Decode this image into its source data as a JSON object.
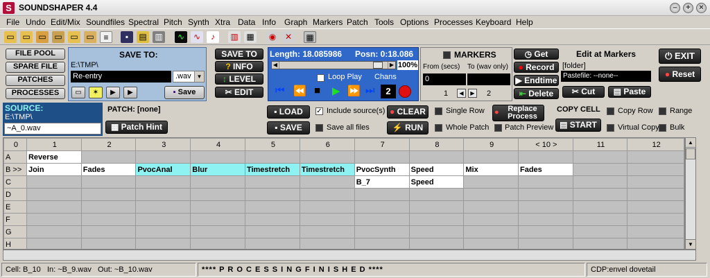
{
  "title_bar": {
    "logo_letter": "S",
    "title": "SOUNDSHAPER 4.4"
  },
  "menu": [
    "File",
    "Undo",
    "Edit/Mix",
    "Soundfiles",
    "Spectral",
    "Pitch",
    "Synth",
    "Xtra",
    "Data",
    "Info",
    "Graph",
    "Markers",
    "Patch",
    "Tools",
    "Options",
    "Processes",
    "Keyboard",
    "Help"
  ],
  "left_buttons": {
    "file_pool": "FILE POOL",
    "spare_file": "SPARE FILE",
    "patches": "PATCHES",
    "processes": "PROCESSES"
  },
  "save_to": {
    "title": "SAVE TO:",
    "path": "E:\\TMP\\",
    "filename": "Re-entry",
    "extension": ".wav",
    "save_label": "Save"
  },
  "mid_buttons": {
    "save_to": "SAVE TO",
    "info": "INFO",
    "level": "LEVEL",
    "edit": "EDIT"
  },
  "transport": {
    "length_label": "Length: 18.085986",
    "posn_label": "Posn: 0:18.086",
    "zoom": "100%",
    "loop_play": "Loop Play",
    "chans_label": "Chans",
    "chans_value": "2",
    "position_fraction": 0.95
  },
  "markers": {
    "title": "MARKERS",
    "from_label": "From (secs)",
    "to_label": "To (wav only)",
    "from_value": "0",
    "to_value": "",
    "index": "1",
    "count": "2"
  },
  "edit_markers": {
    "get": "Get",
    "title": "Edit at Markers",
    "folder": "[folder]",
    "record": "Record",
    "endtime": "Endtime",
    "pastefile": "Pastefile: --none--",
    "delete": "Delete",
    "cut": "Cut",
    "paste": "Paste"
  },
  "right_buttons": {
    "exit": "EXIT",
    "reset": "Reset"
  },
  "source": {
    "label": "SOURCE:",
    "path": "E:\\TMP\\",
    "filename": "~A_0.wav"
  },
  "patch": {
    "title": "PATCH: [none]",
    "patch_hint": "Patch Hint",
    "load": "LOAD",
    "save": "SAVE",
    "include_sources": "Include source(s)",
    "save_all_files": "Save all files",
    "clear": "CLEAR",
    "run": "RUN",
    "single_row": "Single Row",
    "whole_patch": "Whole Patch",
    "replace_process": "Replace Process",
    "patch_preview": "Patch Preview"
  },
  "copy_cell": {
    "title": "COPY CELL",
    "start": "START",
    "copy_row": "Copy Row",
    "range": "Range",
    "virtual_copy": "Virtual Copy",
    "bulk": "Bulk"
  },
  "grid": {
    "columns": [
      "0",
      "1",
      "2",
      "3",
      "4",
      "5",
      "6",
      "7",
      "8",
      "9",
      "< 10 >",
      "11",
      "12"
    ],
    "rows": [
      {
        "label": "A",
        "cells": [
          {
            "t": "Reverse",
            "s": "w"
          },
          {
            "t": "",
            "s": "e"
          },
          {
            "t": "",
            "s": "e"
          },
          {
            "t": "",
            "s": "e"
          },
          {
            "t": "",
            "s": "e"
          },
          {
            "t": "",
            "s": "e"
          },
          {
            "t": "",
            "s": "e"
          },
          {
            "t": "",
            "s": "e"
          },
          {
            "t": "",
            "s": "e"
          },
          {
            "t": "",
            "s": "e"
          },
          {
            "t": "",
            "s": "e"
          },
          {
            "t": "",
            "s": "e"
          }
        ]
      },
      {
        "label": "B >>",
        "cells": [
          {
            "t": "Join",
            "s": "w"
          },
          {
            "t": "Fades",
            "s": "w"
          },
          {
            "t": "PvocAnal",
            "s": "c"
          },
          {
            "t": "Blur",
            "s": "c"
          },
          {
            "t": "Timestretch",
            "s": "c"
          },
          {
            "t": "Timestretch",
            "s": "c"
          },
          {
            "t": "PvocSynth",
            "s": "w"
          },
          {
            "t": "Speed",
            "s": "w"
          },
          {
            "t": "Mix",
            "s": "w"
          },
          {
            "t": "Fades",
            "s": "w"
          },
          {
            "t": "",
            "s": "e"
          },
          {
            "t": "",
            "s": "e"
          }
        ]
      },
      {
        "label": "C",
        "cells": [
          {
            "t": "",
            "s": "e"
          },
          {
            "t": "",
            "s": "e"
          },
          {
            "t": "",
            "s": "e"
          },
          {
            "t": "",
            "s": "e"
          },
          {
            "t": "",
            "s": "e"
          },
          {
            "t": "",
            "s": "e"
          },
          {
            "t": "B_7",
            "s": "w"
          },
          {
            "t": "Speed",
            "s": "w"
          },
          {
            "t": "",
            "s": "e"
          },
          {
            "t": "",
            "s": "e"
          },
          {
            "t": "",
            "s": "e"
          },
          {
            "t": "",
            "s": "e"
          }
        ]
      },
      {
        "label": "D",
        "cells": [
          {
            "t": "",
            "s": "e"
          },
          {
            "t": "",
            "s": "e"
          },
          {
            "t": "",
            "s": "e"
          },
          {
            "t": "",
            "s": "e"
          },
          {
            "t": "",
            "s": "e"
          },
          {
            "t": "",
            "s": "e"
          },
          {
            "t": "",
            "s": "e"
          },
          {
            "t": "",
            "s": "e"
          },
          {
            "t": "",
            "s": "e"
          },
          {
            "t": "",
            "s": "e"
          },
          {
            "t": "",
            "s": "e"
          },
          {
            "t": "",
            "s": "e"
          }
        ]
      },
      {
        "label": "E",
        "cells": [
          {
            "t": "",
            "s": "e"
          },
          {
            "t": "",
            "s": "e"
          },
          {
            "t": "",
            "s": "e"
          },
          {
            "t": "",
            "s": "e"
          },
          {
            "t": "",
            "s": "e"
          },
          {
            "t": "",
            "s": "e"
          },
          {
            "t": "",
            "s": "e"
          },
          {
            "t": "",
            "s": "e"
          },
          {
            "t": "",
            "s": "e"
          },
          {
            "t": "",
            "s": "e"
          },
          {
            "t": "",
            "s": "e"
          },
          {
            "t": "",
            "s": "e"
          }
        ]
      },
      {
        "label": "F",
        "cells": [
          {
            "t": "",
            "s": "e"
          },
          {
            "t": "",
            "s": "e"
          },
          {
            "t": "",
            "s": "e"
          },
          {
            "t": "",
            "s": "e"
          },
          {
            "t": "",
            "s": "e"
          },
          {
            "t": "",
            "s": "e"
          },
          {
            "t": "",
            "s": "e"
          },
          {
            "t": "",
            "s": "e"
          },
          {
            "t": "",
            "s": "e"
          },
          {
            "t": "",
            "s": "e"
          },
          {
            "t": "",
            "s": "e"
          },
          {
            "t": "",
            "s": "e"
          }
        ]
      },
      {
        "label": "G",
        "cells": [
          {
            "t": "",
            "s": "e"
          },
          {
            "t": "",
            "s": "e"
          },
          {
            "t": "",
            "s": "e"
          },
          {
            "t": "",
            "s": "e"
          },
          {
            "t": "",
            "s": "e"
          },
          {
            "t": "",
            "s": "e"
          },
          {
            "t": "",
            "s": "e"
          },
          {
            "t": "",
            "s": "e"
          },
          {
            "t": "",
            "s": "e"
          },
          {
            "t": "",
            "s": "e"
          },
          {
            "t": "",
            "s": "e"
          },
          {
            "t": "",
            "s": "e"
          }
        ]
      },
      {
        "label": "H",
        "cells": [
          {
            "t": "",
            "s": "e"
          },
          {
            "t": "",
            "s": "e"
          },
          {
            "t": "",
            "s": "e"
          },
          {
            "t": "",
            "s": "e"
          },
          {
            "t": "",
            "s": "e"
          },
          {
            "t": "",
            "s": "e"
          },
          {
            "t": "",
            "s": "e"
          },
          {
            "t": "",
            "s": "e"
          },
          {
            "t": "",
            "s": "e"
          },
          {
            "t": "",
            "s": "e"
          },
          {
            "t": "",
            "s": "e"
          },
          {
            "t": "",
            "s": "e"
          }
        ]
      }
    ]
  },
  "status": {
    "cell": "Cell: B_10",
    "in": "In: ~B_9.wav",
    "out": "Out: ~B_10.wav",
    "message": "**** P R O C E S S I N G   F I N I S H E D ****",
    "cdp": "CDP:envel dovetail"
  },
  "colors": {
    "accent_blue": "#3a64c8",
    "cyan_cell": "#8ef2f2",
    "transport_blue": "#2f68c8",
    "record_red": "#e01010"
  }
}
